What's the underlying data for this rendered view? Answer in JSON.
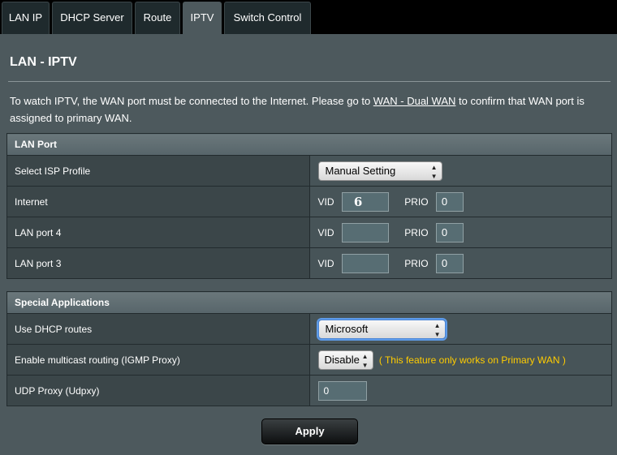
{
  "tabs": [
    "LAN IP",
    "DHCP Server",
    "Route",
    "IPTV",
    "Switch Control"
  ],
  "page": {
    "title": "LAN - IPTV",
    "desc_before": "To watch IPTV, the WAN port must be connected to the Internet. Please go to ",
    "desc_link": "WAN - Dual WAN",
    "desc_after": " to confirm that WAN port is assigned to primary WAN."
  },
  "lan_port": {
    "header": "LAN Port",
    "isp_label": "Select ISP Profile",
    "isp_value": "Manual Setting",
    "vid_label": "VID",
    "prio_label": "PRIO",
    "internet": {
      "label": "Internet",
      "vid": "6",
      "prio": "0"
    },
    "lan4": {
      "label": "LAN port 4",
      "vid": "",
      "prio": "0"
    },
    "lan3": {
      "label": "LAN port 3",
      "vid": "",
      "prio": "0"
    }
  },
  "special": {
    "header": "Special Applications",
    "dhcp_label": "Use DHCP routes",
    "dhcp_value": "Microsoft",
    "igmp_label": "Enable multicast routing (IGMP Proxy)",
    "igmp_value": "Disable",
    "igmp_note": "( This feature only works on Primary WAN )",
    "udp_label": "UDP Proxy (Udpxy)",
    "udp_value": "0"
  },
  "apply_label": "Apply",
  "icons": {
    "select_arrow": "updown-arrows-icon"
  },
  "colors": {
    "background": "#4d595d",
    "note": "#ffcc00",
    "focus": "#5e9be8"
  }
}
